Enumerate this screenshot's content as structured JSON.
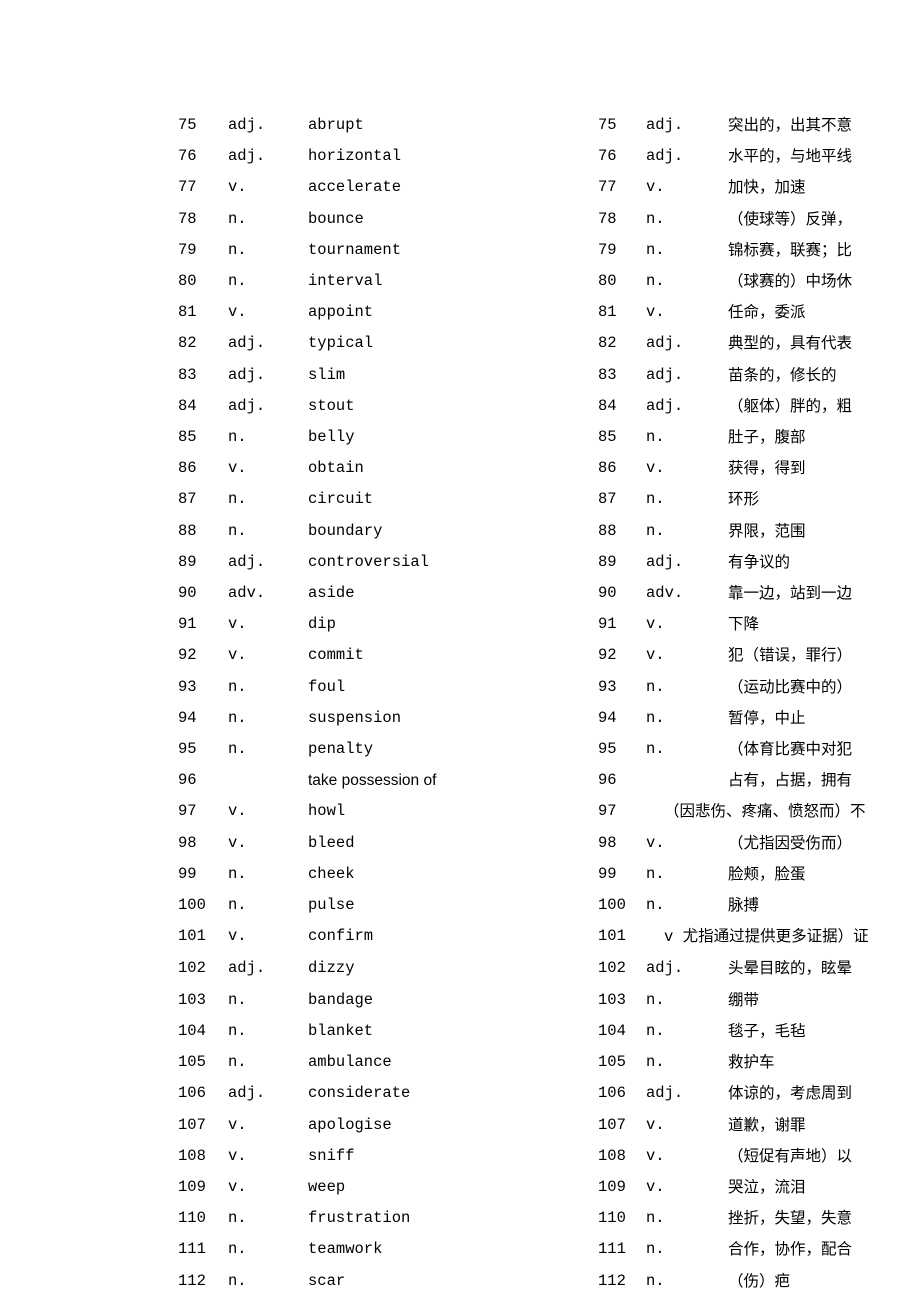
{
  "rows": [
    {
      "n": "75",
      "posL": "adj.",
      "word": "abrupt",
      "posR": "adj.",
      "def": "突出的，出其不意"
    },
    {
      "n": "76",
      "posL": "adj.",
      "word": "horizontal",
      "posR": "adj.",
      "def": "水平的，与地平线"
    },
    {
      "n": "77",
      "posL": "v.",
      "word": "accelerate",
      "posR": "v.",
      "def": "加快，加速"
    },
    {
      "n": "78",
      "posL": "n.",
      "word": "bounce",
      "posR": "n.",
      "def": "（使球等）反弹，"
    },
    {
      "n": "79",
      "posL": "n.",
      "word": "tournament",
      "posR": "n.",
      "def": "锦标赛，联赛；比"
    },
    {
      "n": "80",
      "posL": "n.",
      "word": "interval",
      "posR": "n.",
      "def": "（球赛的）中场休"
    },
    {
      "n": "81",
      "posL": "v.",
      "word": "appoint",
      "posR": "v.",
      "def": "任命，委派"
    },
    {
      "n": "82",
      "posL": "adj.",
      "word": "typical",
      "posR": "adj.",
      "def": "典型的，具有代表"
    },
    {
      "n": "83",
      "posL": "adj.",
      "word": "slim",
      "posR": "adj.",
      "def": "苗条的，修长的"
    },
    {
      "n": "84",
      "posL": "adj.",
      "word": "stout",
      "posR": "adj.",
      "def": "（躯体）胖的，粗"
    },
    {
      "n": "85",
      "posL": "n.",
      "word": "belly",
      "posR": "n.",
      "def": "肚子，腹部"
    },
    {
      "n": "86",
      "posL": "v.",
      "word": "obtain",
      "posR": "v.",
      "def": "获得，得到"
    },
    {
      "n": "87",
      "posL": "n.",
      "word": "circuit",
      "posR": "n.",
      "def": "环形"
    },
    {
      "n": "88",
      "posL": "n.",
      "word": "boundary",
      "posR": "n.",
      "def": "界限，范围"
    },
    {
      "n": "89",
      "posL": "adj.",
      "word": "controversial",
      "posR": "adj.",
      "def": "有争议的"
    },
    {
      "n": "90",
      "posL": "adv.",
      "word": "aside",
      "posR": "adv.",
      "def": "靠一边，站到一边"
    },
    {
      "n": "91",
      "posL": "v.",
      "word": "dip",
      "posR": "v.",
      "def": "下降"
    },
    {
      "n": "92",
      "posL": "v.",
      "word": "commit",
      "posR": "v.",
      "def": "犯（错误，罪行）"
    },
    {
      "n": "93",
      "posL": "n.",
      "word": "foul",
      "posR": "n.",
      "def": "（运动比赛中的）"
    },
    {
      "n": "94",
      "posL": "n.",
      "word": "suspension",
      "posR": "n.",
      "def": "暂停，中止"
    },
    {
      "n": "95",
      "posL": "n.",
      "word": "penalty",
      "posR": "n.",
      "def": "（体育比赛中对犯"
    },
    {
      "n": "96",
      "posL": "",
      "word": "take possession of",
      "wordSans": true,
      "posR": "",
      "def": "占有，占据，拥有"
    },
    {
      "n": "97",
      "posL": "v.",
      "word": "howl",
      "wide": true,
      "def": "（因悲伤、疼痛、愤怒而）不"
    },
    {
      "n": "98",
      "posL": "v.",
      "word": "bleed",
      "posR": "v.",
      "def": "（尤指因受伤而）"
    },
    {
      "n": "99",
      "posL": "n.",
      "word": "cheek",
      "posR": "n.",
      "def": "脸颊，脸蛋"
    },
    {
      "n": "100",
      "posL": "n.",
      "word": "pulse",
      "posR": "n.",
      "def": "脉搏"
    },
    {
      "n": "101",
      "posL": "v.",
      "word": "confirm",
      "wide": true,
      "prefix": "v ",
      "def": "尤指通过提供更多证据）证"
    },
    {
      "n": "102",
      "posL": "adj.",
      "word": "dizzy",
      "posR": "adj.",
      "def": "头晕目眩的，眩晕"
    },
    {
      "n": "103",
      "posL": "n.",
      "word": "bandage",
      "posR": "n.",
      "def": "绷带"
    },
    {
      "n": "104",
      "posL": "n.",
      "word": "blanket",
      "posR": "n.",
      "def": "毯子，毛毡"
    },
    {
      "n": "105",
      "posL": "n.",
      "word": "ambulance",
      "posR": "n.",
      "def": "救护车"
    },
    {
      "n": "106",
      "posL": "adj.",
      "word": "considerate",
      "posR": "adj.",
      "def": "体谅的，考虑周到"
    },
    {
      "n": "107",
      "posL": "v.",
      "word": "apologise",
      "posR": "v.",
      "def": "道歉，谢罪"
    },
    {
      "n": "108",
      "posL": "v.",
      "word": "sniff",
      "posR": "v.",
      "def": "（短促有声地）以"
    },
    {
      "n": "109",
      "posL": "v.",
      "word": "weep",
      "posR": "v.",
      "def": "哭泣，流泪"
    },
    {
      "n": "110",
      "posL": "n.",
      "word": "frustration",
      "posR": "n.",
      "def": "挫折，失望，失意"
    },
    {
      "n": "111",
      "posL": "n.",
      "word": "teamwork",
      "posR": "n.",
      "def": "合作，协作，配合"
    },
    {
      "n": "112",
      "posL": "n.",
      "word": "scar",
      "posR": "n.",
      "def": "（伤）疤"
    }
  ]
}
